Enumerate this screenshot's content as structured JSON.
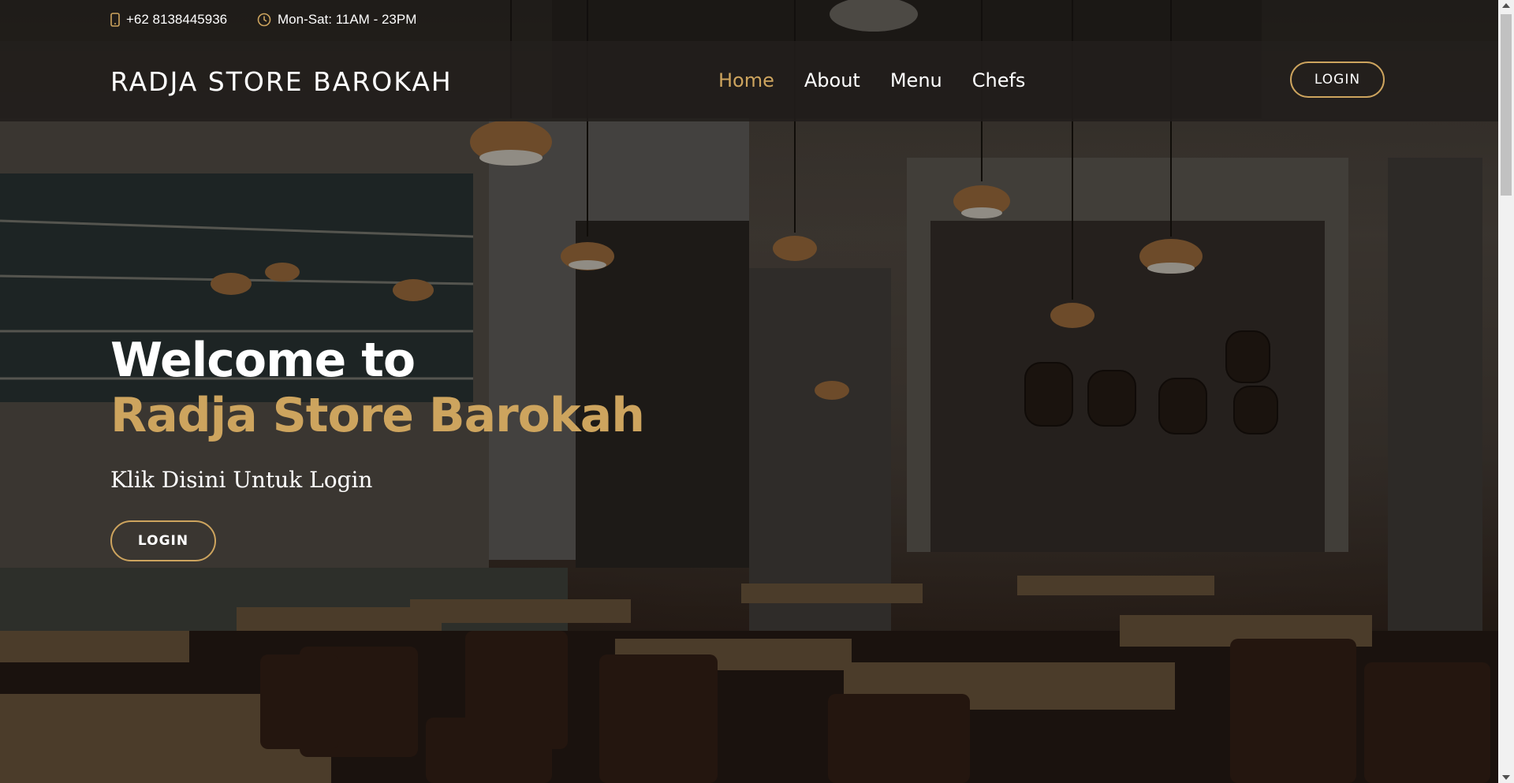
{
  "topbar": {
    "phone": "+62 8138445936",
    "phone_icon": "phone-icon",
    "hours": "Mon-Sat: 11AM - 23PM",
    "hours_icon": "clock-icon"
  },
  "header": {
    "logo": "RADJA STORE BAROKAH",
    "nav": [
      {
        "label": "Home",
        "active": true
      },
      {
        "label": "About",
        "active": false
      },
      {
        "label": "Menu",
        "active": false
      },
      {
        "label": "Chefs",
        "active": false
      }
    ],
    "login_label": "LOGIN"
  },
  "hero": {
    "title_line1": "Welcome to",
    "title_line2": "Radja Store Barokah",
    "subtitle": "Klik Disini Untuk Login",
    "login_label": "LOGIN"
  },
  "colors": {
    "accent": "#cda45e",
    "header_bg": "#211e1b",
    "text": "#ffffff"
  }
}
